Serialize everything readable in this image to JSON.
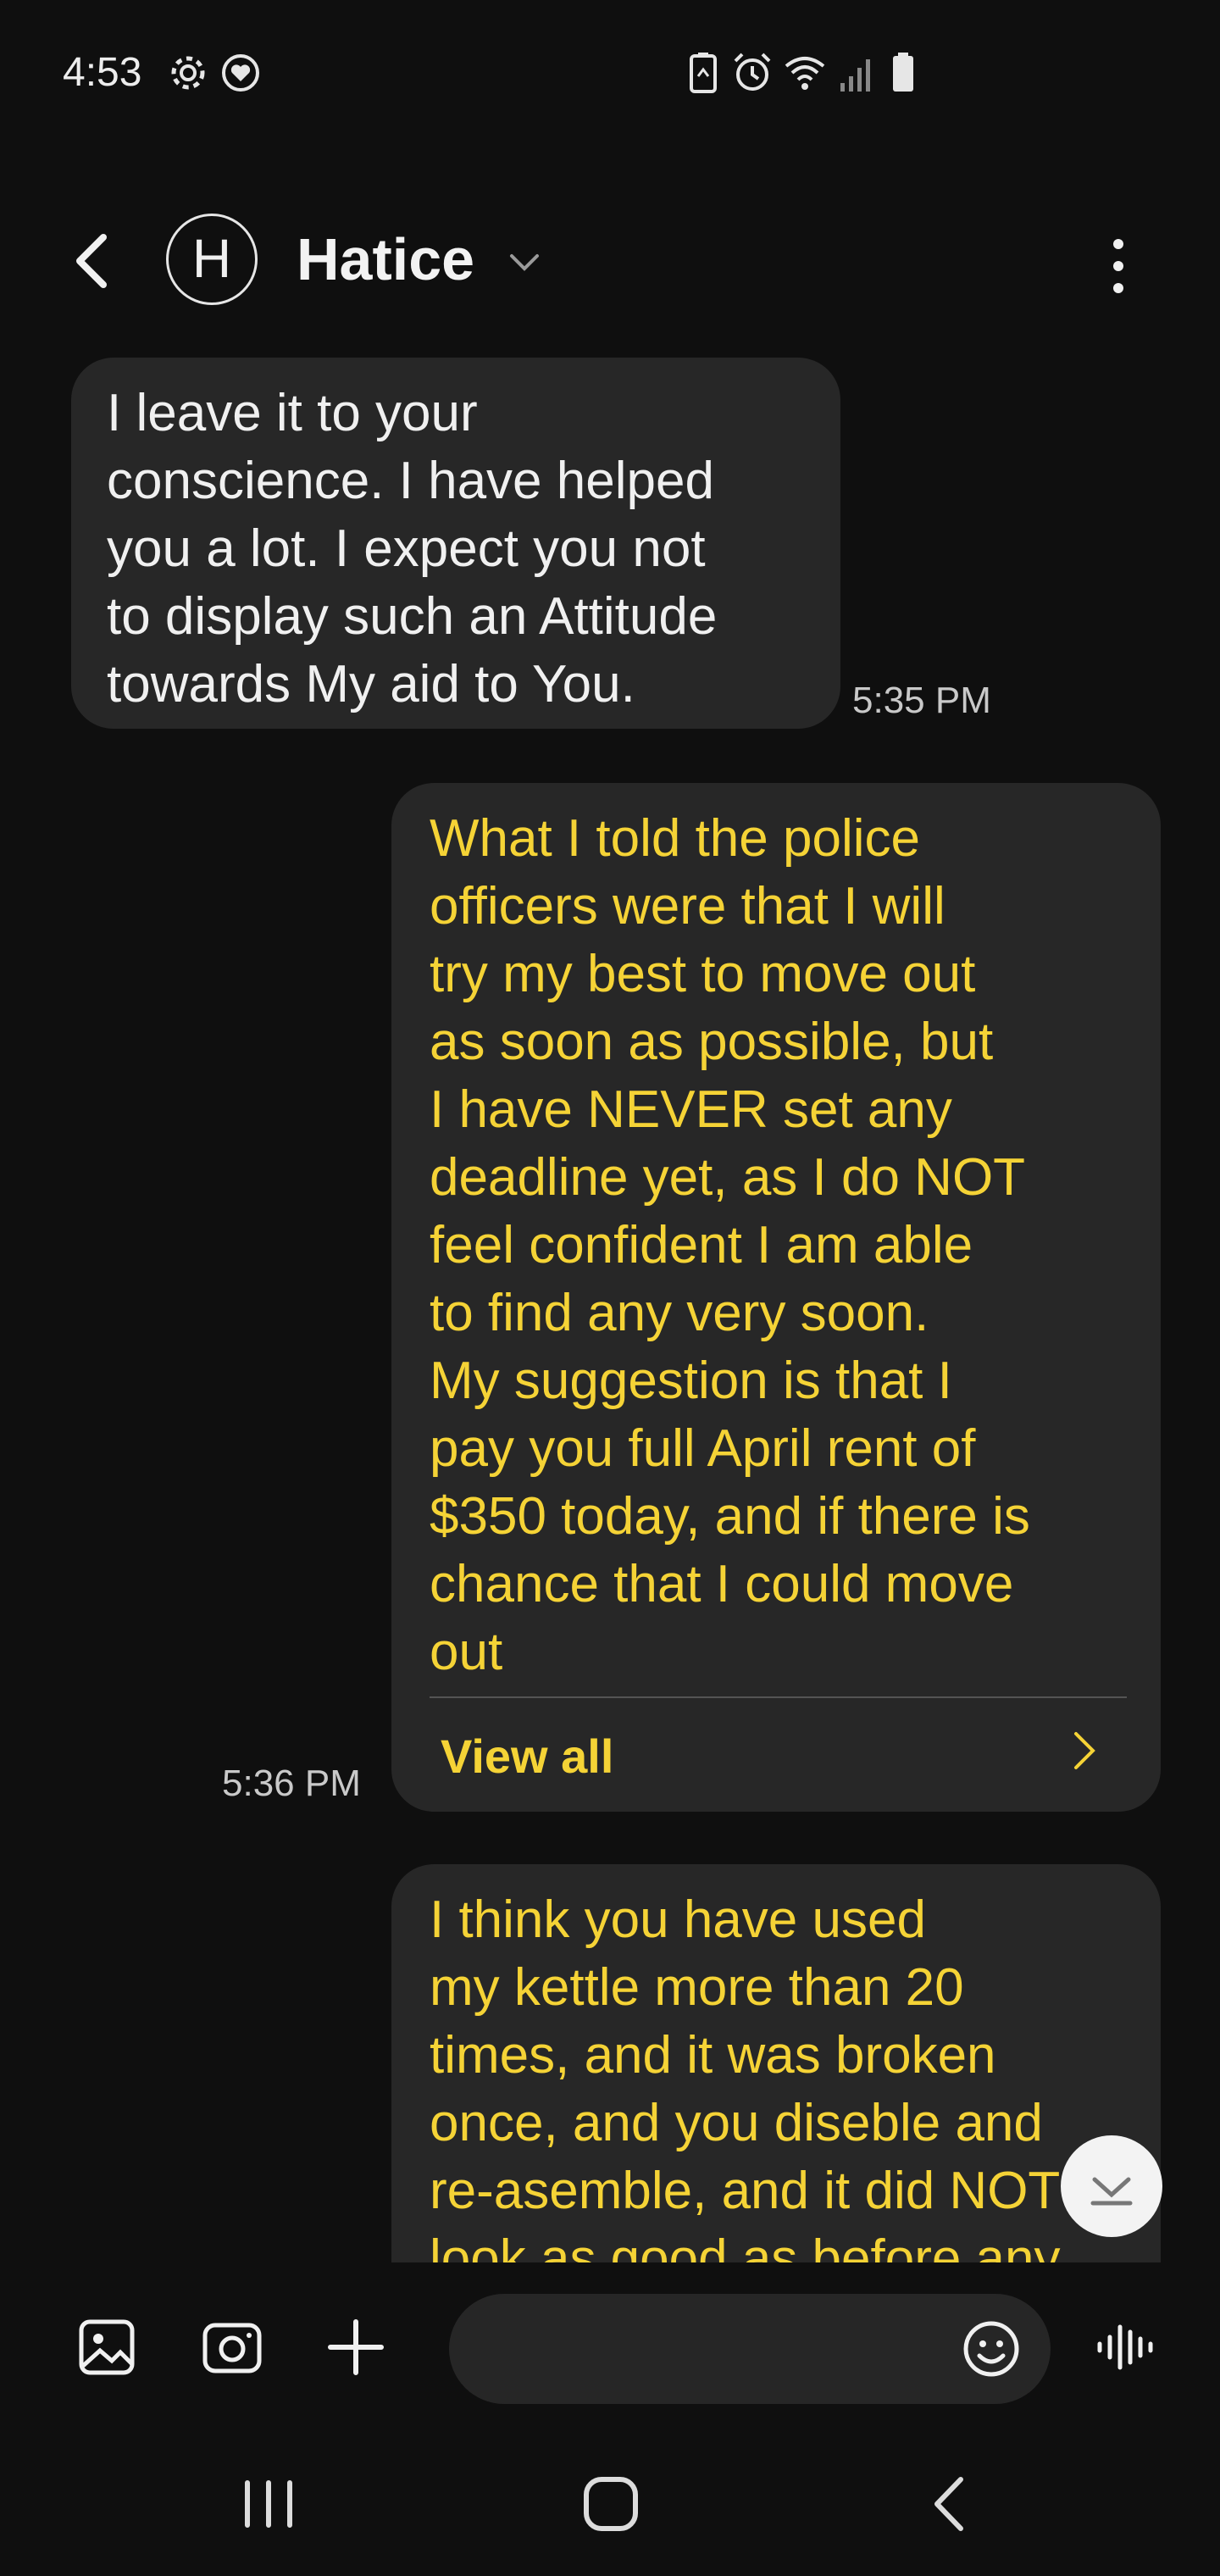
{
  "status_bar": {
    "time": "4:53",
    "left_icons": [
      "gear-icon",
      "heart-shield-icon"
    ],
    "right_icons": [
      "battery-saver-icon",
      "alarm-icon",
      "wifi-icon",
      "signal-icon",
      "battery-icon"
    ]
  },
  "header": {
    "back_icon": "back-arrow-icon",
    "avatar_letter": "H",
    "contact_name": "Hatice",
    "dropdown_icon": "chevron-down-icon",
    "more_icon": "more-vertical-icon"
  },
  "messages": [
    {
      "direction": "incoming",
      "text": "I leave it to your\nconscience. I have helped\nyou a lot. I expect you not\nto display such an Attitude\ntowards My aid to You.",
      "time": "5:35 PM"
    },
    {
      "direction": "outgoing",
      "text": "What I told the police\nofficers were that I will\ntry my best to move out\nas soon as possible, but\nI have NEVER set any\ndeadline yet, as I do NOT\nfeel confident I am able\nto find any very soon.\nMy suggestion is that I\npay you full April rent of\n$350 today, and if there is\nchance that I could move\nout",
      "time": "5:36 PM",
      "view_all_label": "View all"
    },
    {
      "direction": "outgoing",
      "text": "I think you have used\nmy kettle more than 20\ntimes, and it was broken\nonce, and you diseble and\nre-asemble, and it did NOT\nlook as good as before any"
    }
  ],
  "composer": {
    "gallery_icon": "image-icon",
    "camera_icon": "camera-icon",
    "add_icon": "plus-icon",
    "input_placeholder": "",
    "emoji_icon": "emoji-icon",
    "voice_icon": "voice-waveform-icon"
  },
  "nav_bar": {
    "recents_icon": "recents-icon",
    "home_icon": "home-icon",
    "back_icon": "back-icon"
  },
  "colors": {
    "background": "#0f0f0f",
    "bubble": "#272727",
    "incoming_text": "#f0f0f0",
    "outgoing_text": "#f5d336"
  }
}
